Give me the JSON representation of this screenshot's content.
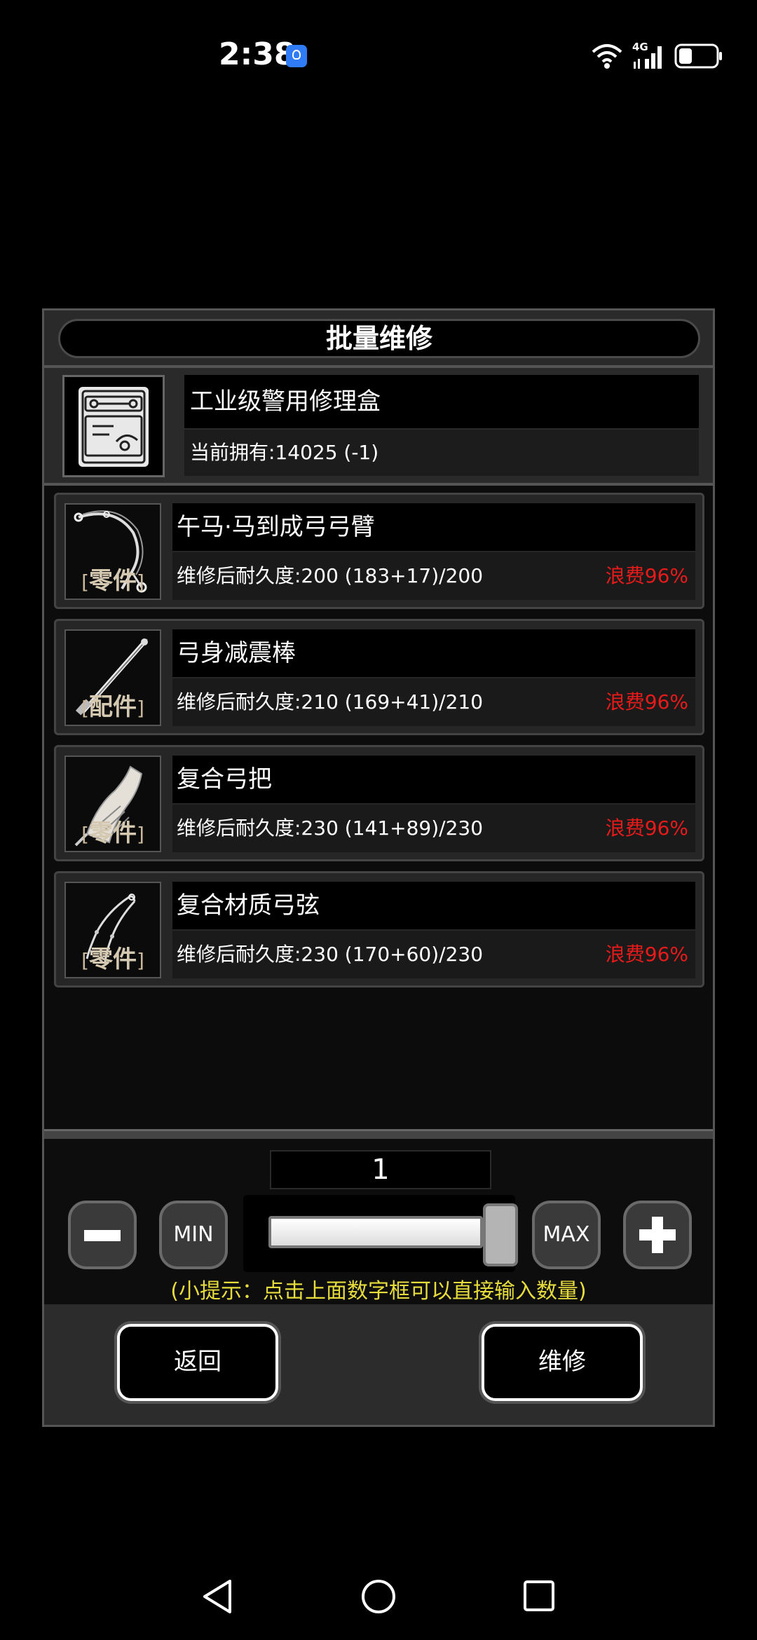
{
  "status_bar": {
    "time": "2:38",
    "network_label": "4G"
  },
  "dialog": {
    "title": "批量维修",
    "repair_kit": {
      "name": "工业级警用修理盒",
      "owned": "当前拥有:14025 (-1)"
    },
    "items": [
      {
        "name": "午马·马到成弓弓臂",
        "durability": "维修后耐久度:200 (183+17)/200",
        "waste": "浪费96%",
        "tag": "零件",
        "icon": "bow-limb-icon"
      },
      {
        "name": "弓身减震棒",
        "durability": "维修后耐久度:210 (169+41)/210",
        "waste": "浪费96%",
        "tag": "配件",
        "icon": "stabilizer-rod-icon"
      },
      {
        "name": "复合弓把",
        "durability": "维修后耐久度:230 (141+89)/230",
        "waste": "浪费96%",
        "tag": "零件",
        "icon": "bow-grip-icon"
      },
      {
        "name": "复合材质弓弦",
        "durability": "维修后耐久度:230 (170+60)/230",
        "waste": "浪费96%",
        "tag": "零件",
        "icon": "bow-string-icon"
      }
    ],
    "quantity": "1",
    "slider_fraction": 1.0,
    "min_label": "MIN",
    "max_label": "MAX",
    "hint": "(小提示：点击上面数字框可以直接输入数量)",
    "back_label": "返回",
    "repair_label": "维修"
  },
  "colors": {
    "waste": "#e81a1a",
    "hint": "#e6dc3c",
    "notification": "#2f7cf6"
  }
}
